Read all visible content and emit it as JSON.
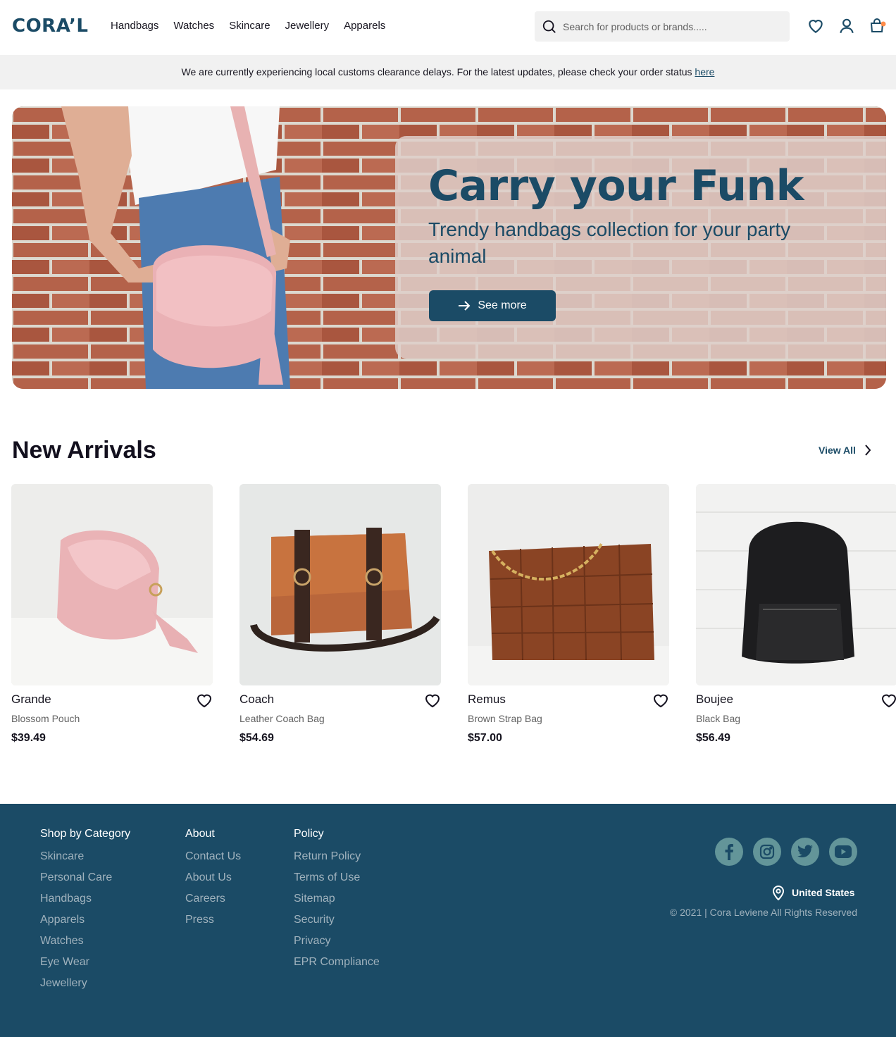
{
  "header": {
    "logo": "CORA’L",
    "nav": [
      "Handbags",
      "Watches",
      "Skincare",
      "Jewellery",
      "Apparels"
    ],
    "search_placeholder": "Search for products or brands.....",
    "icons": [
      "heart-icon",
      "user-icon",
      "bag-icon"
    ]
  },
  "notice": {
    "text": "We are currently experiencing local customs clearance delays. For the latest updates, please check your order status ",
    "link": "here"
  },
  "hero": {
    "title": "Carry your Funk",
    "subtitle": "Trendy handbags collection for your party animal",
    "button": "See more"
  },
  "arrivals": {
    "title": "New Arrivals",
    "view_all": "View All",
    "products": [
      {
        "name": "Grande",
        "desc": "Blossom Pouch",
        "price": "$39.49"
      },
      {
        "name": "Coach",
        "desc": "Leather Coach Bag",
        "price": "$54.69"
      },
      {
        "name": "Remus",
        "desc": "Brown Strap Bag",
        "price": "$57.00"
      },
      {
        "name": "Boujee",
        "desc": "Black Bag",
        "price": "$56.49"
      }
    ]
  },
  "footer": {
    "shop": {
      "title": "Shop by Category",
      "links": [
        "Skincare",
        "Personal Care",
        "Handbags",
        "Apparels",
        "Watches",
        "Eye Wear",
        "Jewellery"
      ]
    },
    "about": {
      "title": "About",
      "links": [
        "Contact Us",
        "About Us",
        "Careers",
        "Press"
      ]
    },
    "policy": {
      "title": "Policy",
      "links": [
        "Return Policy",
        "Terms of Use",
        "Sitemap",
        "Security",
        "Privacy",
        "EPR Compliance"
      ]
    },
    "social": [
      "facebook-icon",
      "instagram-icon",
      "twitter-icon",
      "youtube-icon"
    ],
    "location": "United States",
    "copyright": "© 2021 | Cora Leviene All Rights Reserved"
  },
  "colors": {
    "primary": "#1b4b66",
    "footer_link": "#a0b2bd",
    "social": "#639599"
  }
}
